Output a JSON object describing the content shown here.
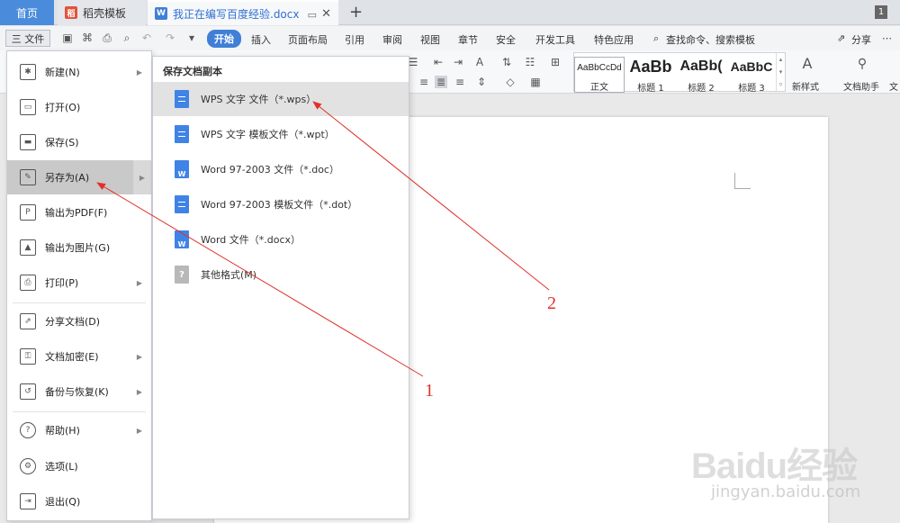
{
  "tabs": {
    "home": "首页",
    "templates": "稻壳模板",
    "document": "我正在编写百度经验.docx",
    "window_count": "1"
  },
  "menu_bar": {
    "file_label": "三 文件",
    "ribbon_tabs": [
      "开始",
      "插入",
      "页面布局",
      "引用",
      "审阅",
      "视图",
      "章节",
      "安全",
      "开发工具",
      "特色应用"
    ],
    "search_placeholder": "查找命令、搜索模板",
    "share_label": "分享"
  },
  "ribbon": {
    "styles": [
      {
        "sample": "AaBbCcDd",
        "name": "正文"
      },
      {
        "sample": "AaBb",
        "name": "标题 1"
      },
      {
        "sample": "AaBb(",
        "name": "标题 2"
      },
      {
        "sample": "AaBbC",
        "name": "标题 3"
      }
    ],
    "new_style": "新样式",
    "doc_assistant": "文档助手",
    "doc_assistant_cut": "文"
  },
  "file_menu": {
    "items": [
      {
        "label": "新建(N)",
        "icon": "new-doc-icon",
        "has_submenu": true
      },
      {
        "label": "打开(O)",
        "icon": "folder-open-icon",
        "has_submenu": false
      },
      {
        "label": "保存(S)",
        "icon": "save-icon",
        "has_submenu": false
      },
      {
        "label": "另存为(A)",
        "icon": "save-as-icon",
        "has_submenu": true
      },
      {
        "label": "输出为PDF(F)",
        "icon": "pdf-icon",
        "has_submenu": false
      },
      {
        "label": "输出为图片(G)",
        "icon": "image-icon",
        "has_submenu": false
      },
      {
        "label": "打印(P)",
        "icon": "print-icon",
        "has_submenu": true
      },
      {
        "label": "分享文档(D)",
        "icon": "share-icon",
        "has_submenu": false
      },
      {
        "label": "文档加密(E)",
        "icon": "lock-doc-icon",
        "has_submenu": true
      },
      {
        "label": "备份与恢复(K)",
        "icon": "backup-icon",
        "has_submenu": true
      },
      {
        "label": "帮助(H)",
        "icon": "help-icon",
        "has_submenu": true
      },
      {
        "label": "选项(L)",
        "icon": "gear-icon",
        "has_submenu": false
      },
      {
        "label": "退出(Q)",
        "icon": "exit-icon",
        "has_submenu": false
      }
    ]
  },
  "save_as_submenu": {
    "title": "保存文档副本",
    "items": [
      {
        "label": "WPS 文字 文件（*.wps）",
        "icon_type": "blue"
      },
      {
        "label": "WPS 文字 模板文件（*.wpt）",
        "icon_type": "blue"
      },
      {
        "label": "Word 97-2003 文件（*.doc）",
        "icon_type": "word"
      },
      {
        "label": "Word 97-2003 模板文件（*.dot）",
        "icon_type": "blue"
      },
      {
        "label": "Word 文件（*.docx）",
        "icon_type": "word"
      },
      {
        "label": "其他格式(M)",
        "icon_type": "gray"
      }
    ]
  },
  "annotations": {
    "label_1": "1",
    "label_2": "2",
    "color": "#e0312a"
  },
  "watermark": {
    "main": "Baidu经验",
    "sub": "jingyan.baidu.com"
  }
}
